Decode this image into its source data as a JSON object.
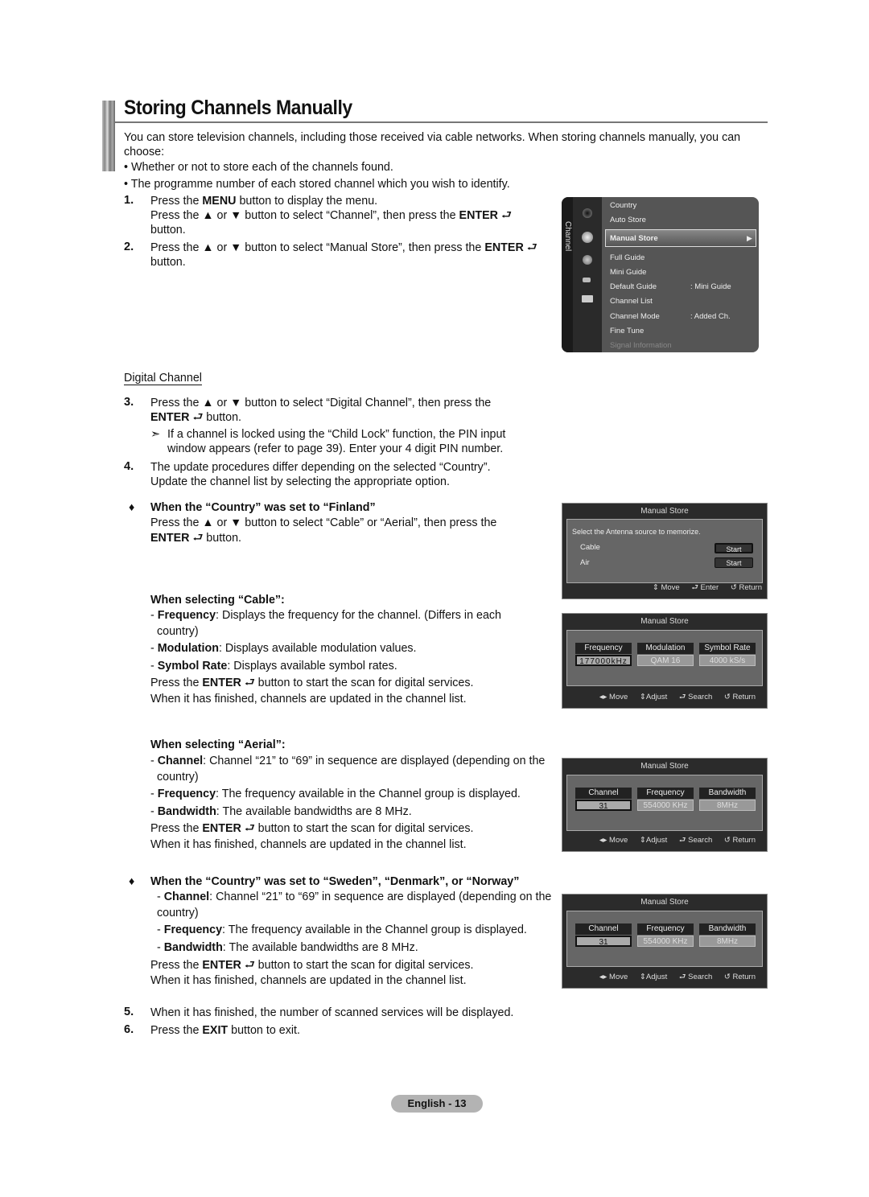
{
  "page": {
    "title": "Storing Channels Manually",
    "intro": "You can store television channels, including those received via cable networks. When storing channels manually, you can choose:",
    "bullets": [
      "Whether or not to store each of the channels found.",
      "The programme number of each stored channel which you wish to identify."
    ],
    "steps": {
      "s1_num": "1.",
      "s1_line1_a": "Press the ",
      "s1_line1_b": "MENU",
      "s1_line1_c": " button to display the menu.",
      "s1_line2_a": "Press the ▲ or ▼ button to select “Channel”, then press the ",
      "s1_line2_b": "ENTER",
      "s1_line3": "button.",
      "s2_num": "2.",
      "s2_line1_a": "Press the ▲ or ▼ button to select “Manual Store”, then press the ",
      "s2_line1_b": "ENTER",
      "s2_line2": "button.",
      "digital_heading": "Digital Channel",
      "s3_num": "3.",
      "s3_line1": "Press the ▲ or ▼ button to select “Digital Channel”, then press the",
      "s3_line2_a": "ENTER",
      "s3_line2_b": " button.",
      "note_arrow": "➣",
      "note_line1": "If a channel is locked using the “Child Lock” function, the PIN input",
      "note_line2": "window appears (refer to page 39). Enter your 4 digit PIN number.",
      "s4_num": "4.",
      "s4_line1": "The update procedures differ depending on the selected “Country”.",
      "s4_line2": "Update the channel list by selecting the appropriate option.",
      "finland_heading": "When the “Country” was set to “Finland”",
      "finland_line1": "Press the ▲ or ▼ button to select “Cable” or “Aerial”, then press the",
      "finland_line2_a": "ENTER",
      "finland_line2_b": " button.",
      "cable_heading": "When selecting “Cable”:",
      "cable_items": [
        {
          "term": "Frequency",
          "desc": ": Displays the frequency for the channel. (Differs in each",
          "desc2": "country)"
        },
        {
          "term": "Modulation",
          "desc": ": Displays available modulation values."
        },
        {
          "term": "Symbol Rate",
          "desc": ": Displays available symbol rates."
        }
      ],
      "enter_scan_a": "Press the ",
      "enter_scan_b": "ENTER",
      "enter_scan_c": " button to start the scan for digital services.",
      "finished_line": "When it has finished, channels are updated in the channel list.",
      "aerial_heading": "When selecting “Aerial”:",
      "aerial_items": [
        {
          "term": "Channel",
          "desc": ": Channel “21” to “69” in sequence are displayed (depending on the",
          "desc2": "country)"
        },
        {
          "term": "Frequency",
          "desc": ": The frequency available in the Channel group is displayed."
        },
        {
          "term": "Bandwidth",
          "desc": ": The available bandwidths are 8 MHz."
        }
      ],
      "nordic_heading": "When the “Country” was set to “Sweden”, “Denmark”, or “Norway”",
      "s5_num": "5.",
      "s5_line": "When it has finished, the number of scanned services will be displayed.",
      "s6_num": "6.",
      "s6_a": "Press the ",
      "s6_b": "EXIT",
      "s6_c": " button to exit.",
      "diamond": "♦"
    },
    "page_badge": "English - 13"
  },
  "osd_menu": {
    "side_label": "Channel",
    "items": [
      {
        "label": "Country",
        "value": ""
      },
      {
        "label": "Auto Store",
        "value": ""
      },
      {
        "label": "Manual Store",
        "value": "",
        "selected": true
      },
      {
        "label": "Full Guide",
        "value": ""
      },
      {
        "label": "Mini Guide",
        "value": ""
      },
      {
        "label": "Default Guide",
        "value": ": Mini Guide"
      },
      {
        "label": "Channel List",
        "value": ""
      },
      {
        "label": "Channel Mode",
        "value": ": Added Ch."
      },
      {
        "label": "Fine Tune",
        "value": ""
      },
      {
        "label": "Signal Information",
        "value": "",
        "disabled": true
      }
    ],
    "arrow": "▶"
  },
  "dialog_source": {
    "title": "Manual Store",
    "prompt": "Select the Antenna source to memorize.",
    "rows": [
      {
        "label": "Cable",
        "button": "Start"
      },
      {
        "label": "Air",
        "button": "Start"
      }
    ],
    "footer": {
      "move": "Move",
      "enter": "Enter",
      "return": "Return"
    }
  },
  "dialog_cable": {
    "title": "Manual Store",
    "columns": [
      {
        "head": "Frequency",
        "value": "177000kHz"
      },
      {
        "head": "Modulation",
        "value": "QAM 16"
      },
      {
        "head": "Symbol Rate",
        "value": "4000 kS/s"
      }
    ],
    "footer": {
      "move": "Move",
      "adjust": "Adjust",
      "search": "Search",
      "return": "Return"
    }
  },
  "dialog_aerial": {
    "title": "Manual Store",
    "columns": [
      {
        "head": "Channel",
        "value": "31"
      },
      {
        "head": "Frequency",
        "value": "554000 KHz"
      },
      {
        "head": "Bandwidth",
        "value": "8MHz"
      }
    ],
    "footer": {
      "move": "Move",
      "adjust": "Adjust",
      "search": "Search",
      "return": "Return"
    }
  },
  "dialog_nordic": {
    "title": "Manual Store",
    "columns": [
      {
        "head": "Channel",
        "value": "31"
      },
      {
        "head": "Frequency",
        "value": "554000 KHz"
      },
      {
        "head": "Bandwidth",
        "value": "8MHz"
      }
    ],
    "footer": {
      "move": "Move",
      "adjust": "Adjust",
      "search": "Search",
      "return": "Return"
    }
  }
}
